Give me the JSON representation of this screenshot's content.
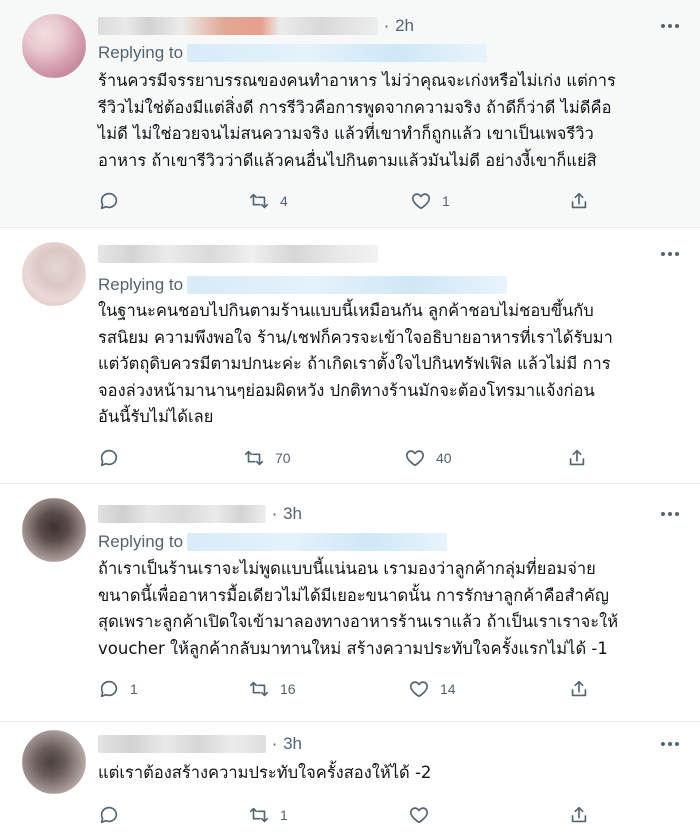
{
  "tweets": [
    {
      "time": "2h",
      "replying_label": "Replying to",
      "lines": [
        "ร้านควรมีจรรยาบรรณของคนทำอาหาร ไม่ว่าคุณจะเก่งหรือไม่เก่ง แต่การ",
        "รีวิวไม่ใช่ต้องมีแต่สิ่งดี การรีวิวคือการพูดจากความจริง ถ้าดีก็ว่าดี ไม่ดีคือ",
        "ไม่ดี ไม่ใช่อวยจนไม่สนความจริง แล้วที่เขาทำก็ถูกแล้ว เขาเป็นเพจรีวิว",
        "อาหาร ถ้าเขารีวิวว่าดีแล้วคนอื่นไปกินตามแล้วมันไม่ดี อย่างงี้เขาก็แย่สิ"
      ],
      "reply_count": "",
      "retweet_count": "4",
      "like_count": "1"
    },
    {
      "time": "",
      "replying_label": "Replying to",
      "lines": [
        "ในฐานะคนชอบไปกินตามร้านแบบนี้เหมือนกัน ลูกค้าชอบไม่ชอบขึ้นกับ",
        "รสนิยม ความพึงพอใจ ร้าน/เชฟก็ควรจะเข้าใจอธิบายอาหารที่เราได้รับมา",
        "แต่วัตถุดิบควรมีตามปกนะค่ะ ถ้าเกิดเราตั้งใจไปกินทรัฟเฟิล แล้วไม่มี การ",
        "จองล่วงหน้ามานานๆย่อมผิดหวัง ปกติทางร้านมักจะต้องโทรมาแจ้งก่อน",
        "อันนี้รับไม่ได้เลย"
      ],
      "reply_count": "",
      "retweet_count": "70",
      "like_count": "40"
    },
    {
      "time": "3h",
      "replying_label": "Replying to",
      "lines": [
        "ถ้าเราเป็นร้านเราจะไม่พูดแบบนี้แน่นอน เรามองว่าลูกค้ากลุ่มที่ยอมจ่าย",
        "ขนาดนี้เพื่ออาหารมื้อเดียวไม่ได้มีเยอะขนาดนั้น การรักษาลูกค้าคือสำคัญ",
        "สุดเพราะลูกค้าเปิดใจเข้ามาลองทางอาหารร้านเราแล้ว ถ้าเป็นเราเราจะให้",
        "voucher ให้ลูกค้ากลับมาทานใหม่ สร้างความประทับใจครั้งแรกไม่ได้ -1"
      ],
      "reply_count": "1",
      "retweet_count": "16",
      "like_count": "14"
    },
    {
      "time": "3h",
      "replying_label": "",
      "lines": [
        "แต่เราต้องสร้างความประทับใจครั้งสองให้ได้ -2"
      ],
      "reply_count": "",
      "retweet_count": "1",
      "like_count": ""
    }
  ],
  "icons": {
    "reply": "comment-icon",
    "retweet": "retweet-icon",
    "like": "heart-icon",
    "share": "share-icon",
    "more": "more-icon"
  },
  "colors": {
    "secondary_text": "#536471",
    "link_blur": "#cfe7f6",
    "highlight_bg": "#f7f9f9"
  }
}
